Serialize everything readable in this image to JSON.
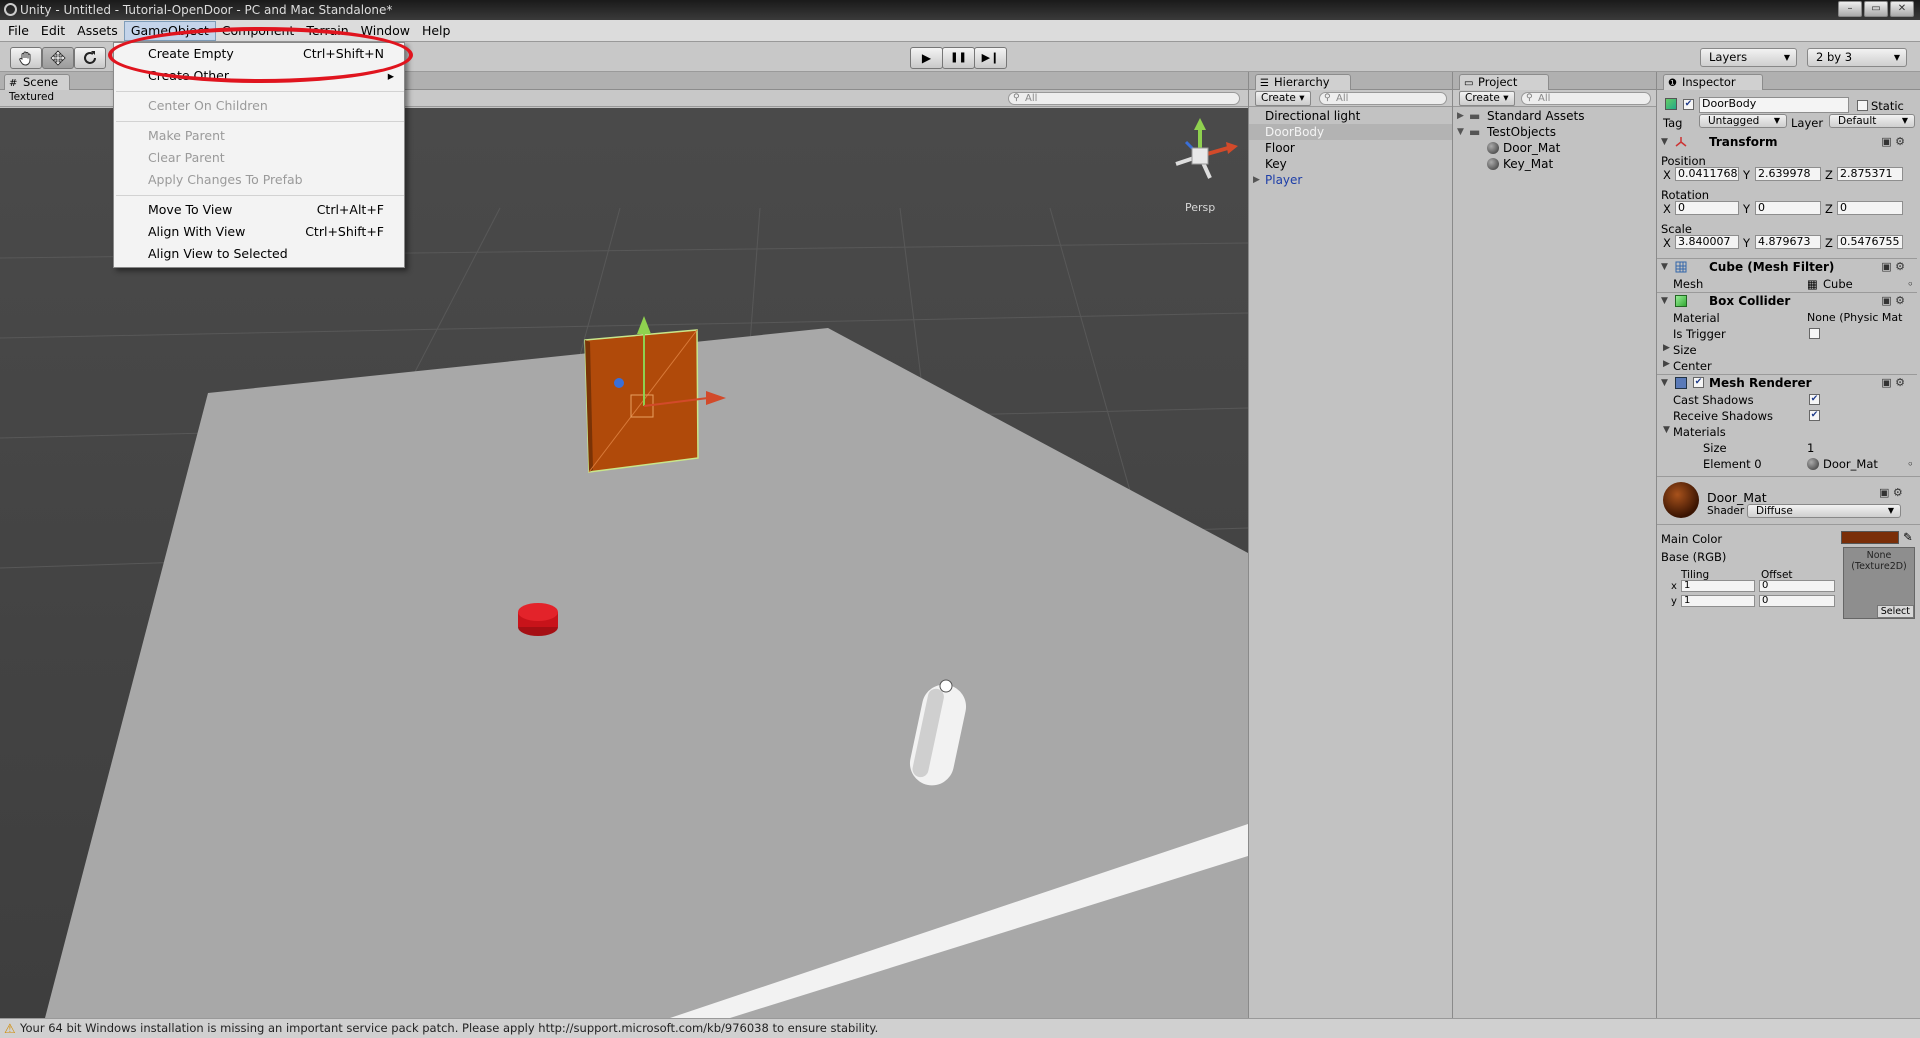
{
  "window": {
    "title": "Unity - Untitled - Tutorial-OpenDoor - PC and Mac Standalone*",
    "controls": [
      "–",
      "▭",
      "✕"
    ]
  },
  "menubar": {
    "items": [
      "File",
      "Edit",
      "Assets",
      "GameObject",
      "Component",
      "Terrain",
      "Window",
      "Help"
    ],
    "active": "GameObject"
  },
  "gameobject_menu": {
    "items": [
      {
        "label": "Create Empty",
        "shortcut": "Ctrl+Shift+N",
        "enabled": true
      },
      {
        "label": "Create Other",
        "shortcut": "",
        "enabled": true,
        "submenu": true
      },
      {
        "label": "Center On Children",
        "shortcut": "",
        "enabled": false
      },
      {
        "label": "Make Parent",
        "shortcut": "",
        "enabled": false
      },
      {
        "label": "Clear Parent",
        "shortcut": "",
        "enabled": false
      },
      {
        "label": "Apply Changes To Prefab",
        "shortcut": "",
        "enabled": false
      },
      {
        "label": "Move To View",
        "shortcut": "Ctrl+Alt+F",
        "enabled": true
      },
      {
        "label": "Align With View",
        "shortcut": "Ctrl+Shift+F",
        "enabled": true
      },
      {
        "label": "Align View to Selected",
        "shortcut": "",
        "enabled": true
      }
    ],
    "submenu_arrow": "▸"
  },
  "toolbar": {
    "tools": [
      "hand-tool",
      "move-tool",
      "rotate-tool"
    ],
    "play": "▶",
    "pause": "❚❚",
    "step": "▶❙",
    "layers_label": "Layers",
    "layout_label": "2 by 3"
  },
  "scene": {
    "tab_label": "Scene",
    "render_mode": "Textured",
    "persp_label": "Persp",
    "search_placeholder": "All",
    "colors": {
      "door": "#b04a0a",
      "floor": "#a8a8a8",
      "sky": "#454545",
      "key": "#d8131b"
    }
  },
  "hierarchy": {
    "tab_label": "Hierarchy",
    "create_label": "Create ▾",
    "search_placeholder": "All",
    "items": [
      {
        "label": "Directional light",
        "selected": false,
        "prefab": false,
        "expandable": false
      },
      {
        "label": "DoorBody",
        "selected": true,
        "prefab": false,
        "expandable": false
      },
      {
        "label": "Floor",
        "selected": false,
        "prefab": false,
        "expandable": false
      },
      {
        "label": "Key",
        "selected": false,
        "prefab": false,
        "expandable": false
      },
      {
        "label": "Player",
        "selected": false,
        "prefab": true,
        "expandable": true
      }
    ]
  },
  "project": {
    "tab_label": "Project",
    "create_label": "Create ▾",
    "search_placeholder": "All",
    "items": [
      {
        "label": "Standard Assets",
        "type": "folder",
        "depth": 0,
        "expanded": false
      },
      {
        "label": "TestObjects",
        "type": "folder",
        "depth": 0,
        "expanded": true
      },
      {
        "label": "Door_Mat",
        "type": "material",
        "depth": 1
      },
      {
        "label": "Key_Mat",
        "type": "material",
        "depth": 1
      }
    ]
  },
  "inspector": {
    "tab_label": "Inspector",
    "object_name": "DoorBody",
    "active": true,
    "static_label": "Static",
    "static": false,
    "tag_label": "Tag",
    "tag_value": "Untagged",
    "layer_label": "Layer",
    "layer_value": "Default",
    "transform": {
      "title": "Transform",
      "position_label": "Position",
      "position": {
        "x": "0.0411768",
        "y": "2.639978",
        "z": "2.875371"
      },
      "rotation_label": "Rotation",
      "rotation": {
        "x": "0",
        "y": "0",
        "z": "0"
      },
      "scale_label": "Scale",
      "scale": {
        "x": "3.840007",
        "y": "4.879673",
        "z": "0.5476755"
      }
    },
    "mesh_filter": {
      "title": "Cube (Mesh Filter)",
      "mesh_label": "Mesh",
      "mesh_value": "Cube"
    },
    "box_collider": {
      "title": "Box Collider",
      "material_label": "Material",
      "material_value": "None (Physic Mat",
      "is_trigger_label": "Is Trigger",
      "is_trigger": false,
      "size_label": "Size",
      "center_label": "Center"
    },
    "mesh_renderer": {
      "title": "Mesh Renderer",
      "enabled": true,
      "cast_shadows_label": "Cast Shadows",
      "cast_shadows": true,
      "receive_shadows_label": "Receive Shadows",
      "receive_shadows": true,
      "materials_label": "Materials",
      "size_label": "Size",
      "size_value": "1",
      "element0_label": "Element 0",
      "element0_value": "Door_Mat"
    },
    "material": {
      "name": "Door_Mat",
      "shader_label": "Shader",
      "shader_value": "Diffuse",
      "main_color_label": "Main Color",
      "main_color": "#7a2e08",
      "base_label": "Base (RGB)",
      "texture_label": "None (Texture2D)",
      "select_label": "Select",
      "tiling_label": "Tiling",
      "offset_label": "Offset",
      "tiling": {
        "x": "1",
        "y": "1"
      },
      "offset": {
        "x": "0",
        "y": "0"
      }
    }
  },
  "status": {
    "message": "Your 64 bit Windows installation is missing an important service pack patch. Please apply http://support.microsoft.com/kb/976038 to ensure stability."
  }
}
